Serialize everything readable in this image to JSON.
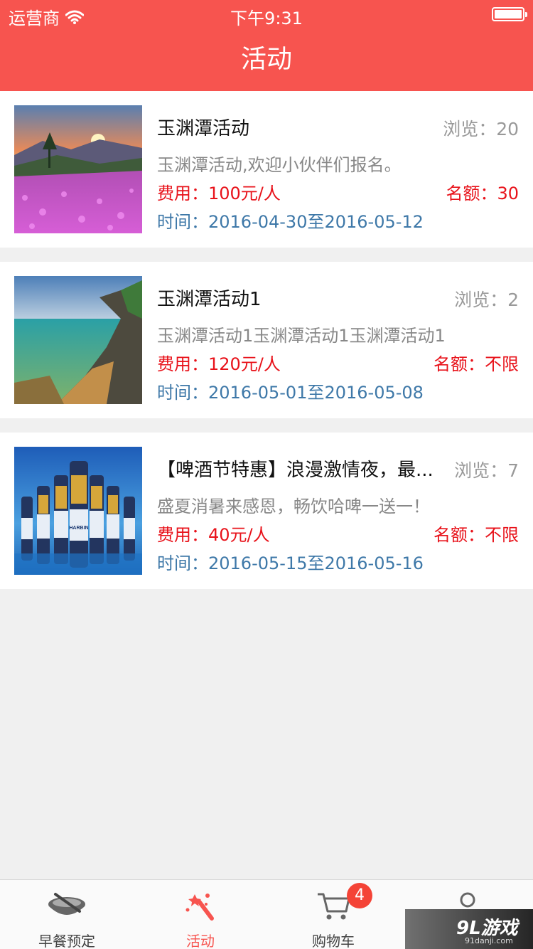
{
  "status_bar": {
    "carrier": "运营商",
    "time": "下午9:31"
  },
  "nav": {
    "title": "活动"
  },
  "activities": [
    {
      "title": "玉渊潭活动",
      "views": "浏览：20",
      "desc": "玉渊潭活动,欢迎小伙伴们报名。",
      "fee": "费用：100元/人",
      "quota": "名额：30",
      "time": "时间：2016-04-30至2016-05-12",
      "image": "flower-field-sunset"
    },
    {
      "title": "玉渊潭活动1",
      "views": "浏览：2",
      "desc": "玉渊潭活动1玉渊潭活动1玉渊潭活动1",
      "fee": "费用：120元/人",
      "quota": "名额：不限",
      "time": "时间：2016-05-01至2016-05-08",
      "image": "coastal-lake"
    },
    {
      "title": "【啤酒节特惠】浪漫激情夜，最...",
      "views": "浏览：7",
      "desc": "盛夏消暑来感恩，畅饮哈啤一送一！",
      "fee": "费用：40元/人",
      "quota": "名额：不限",
      "time": "时间：2016-05-15至2016-05-16",
      "image": "beer-bottles",
      "image_text": "HARBIN"
    }
  ],
  "tabs": [
    {
      "label": "早餐预定",
      "icon": "food-bowl-icon"
    },
    {
      "label": "活动",
      "icon": "magic-wand-icon"
    },
    {
      "label": "购物车",
      "icon": "cart-icon",
      "badge": "4"
    },
    {
      "label": "",
      "icon": "user-icon"
    }
  ],
  "watermark": {
    "main": "9L游戏",
    "sub": "91danji.com"
  },
  "colors": {
    "brand": "#f7544f",
    "price": "#e8121a",
    "time": "#3e78a8"
  }
}
